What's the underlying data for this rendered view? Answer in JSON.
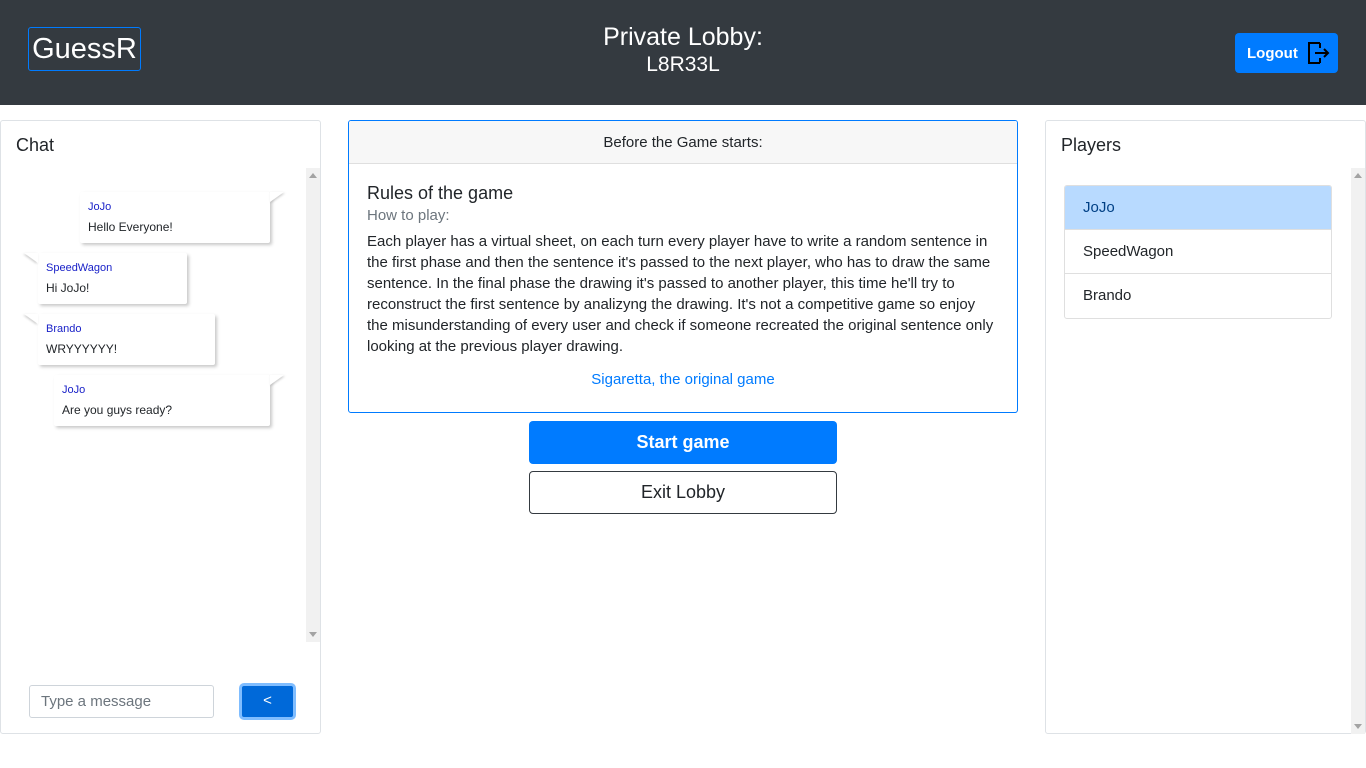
{
  "header": {
    "brand": "GuessR",
    "lobby_title": "Private Lobby:",
    "lobby_code": "L8R33L",
    "logout_label": "Logout"
  },
  "chat": {
    "title": "Chat",
    "messages": [
      {
        "author": "JoJo",
        "text": "Hello Everyone!",
        "own": true
      },
      {
        "author": "SpeedWagon",
        "text": "Hi JoJo!",
        "own": false
      },
      {
        "author": "Brando",
        "text": "WRYYYYYY!",
        "own": false
      },
      {
        "author": "JoJo",
        "text": "Are you guys ready?",
        "own": true
      }
    ],
    "input_placeholder": "Type a message",
    "input_value": "",
    "send_label": "<"
  },
  "rules": {
    "header": "Before the Game starts:",
    "title": "Rules of the game",
    "subtitle": "How to play:",
    "text": "Each player has a virtual sheet, on each turn every player have to write a random sentence in the first phase and then the sentence it's passed to the next player, who has to draw the same sentence. In the final phase the drawing it's passed to another player, this time he'll try to reconstruct the first sentence by analizyng the drawing. It's not a competitive game so enjoy the misunderstanding of every user and check if someone recreated the original sentence only looking at the previous player drawing.",
    "link_label": "Sigaretta, the original game"
  },
  "actions": {
    "start_label": "Start game",
    "exit_label": "Exit Lobby"
  },
  "players": {
    "title": "Players",
    "items": [
      {
        "name": "JoJo",
        "active": true
      },
      {
        "name": "SpeedWagon",
        "active": false
      },
      {
        "name": "Brando",
        "active": false
      }
    ]
  },
  "colors": {
    "header_bg": "#343a40",
    "primary": "#007bff",
    "active_player_bg": "#b8daff",
    "chat_author": "#1a22c8"
  },
  "icons": {
    "logout": "logout-icon",
    "scroll_up": "scroll-up-arrow",
    "scroll_down": "scroll-down-arrow"
  }
}
